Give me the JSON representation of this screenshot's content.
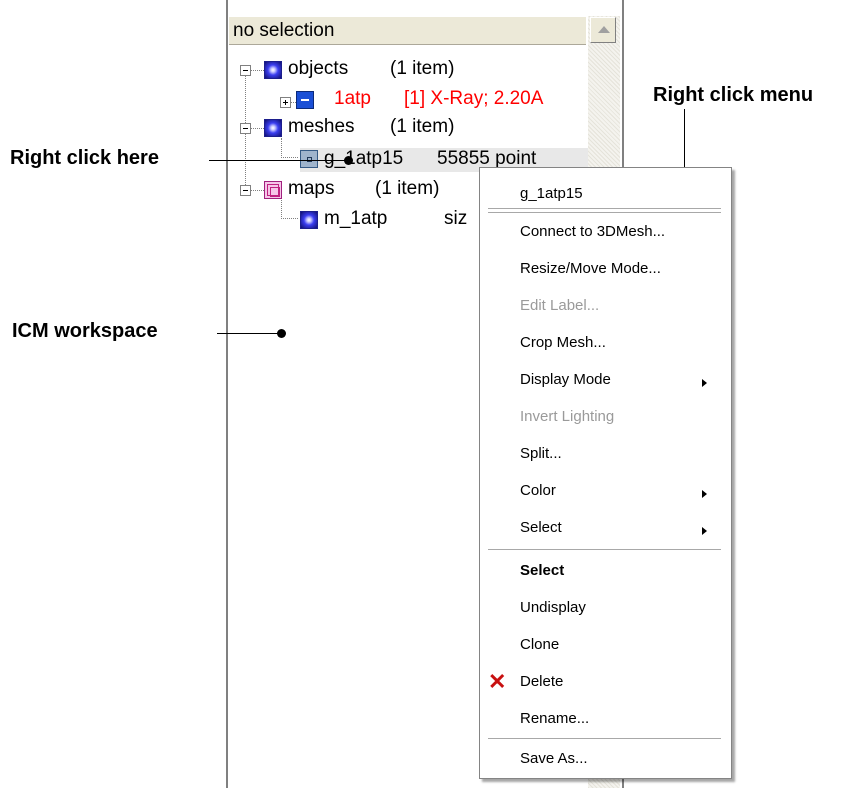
{
  "workspace": {
    "header": "no selection"
  },
  "tree": {
    "objects": {
      "label": "objects",
      "count": "(1 item)"
    },
    "object_item": {
      "name": "1atp",
      "detail": "[1] X-Ray; 2.20A"
    },
    "meshes": {
      "label": "meshes",
      "count": "(1 item)"
    },
    "mesh_item": {
      "name": "g_1atp15",
      "detail": "55855 point"
    },
    "maps": {
      "label": "maps",
      "count": "(1 item)"
    },
    "map_item": {
      "name": "m_1atp",
      "detail": "siz"
    }
  },
  "annotations": {
    "right_click_menu": "Right click menu",
    "right_click_here": "Right click here",
    "icm_workspace": "ICM workspace"
  },
  "menu": {
    "title": "g_1atp15",
    "items": {
      "connect": "Connect to 3DMesh...",
      "resize": "Resize/Move Mode...",
      "edit_label": "Edit Label...",
      "crop": "Crop Mesh...",
      "display_mode": "Display Mode",
      "invert": "Invert Lighting",
      "split": "Split...",
      "color": "Color",
      "select_sub": "Select",
      "select": "Select",
      "undisplay": "Undisplay",
      "clone": "Clone",
      "delete": "Delete",
      "rename": "Rename...",
      "save_as": "Save As..."
    }
  },
  "icons": {
    "objects": "sphere-icon",
    "object_item": "minus-square-icon",
    "meshes": "sphere-icon",
    "mesh_item": "mesh-icon",
    "maps": "map-icon",
    "map_item": "sphere-icon",
    "delete": "red-x-icon",
    "submenu": "triangle-right-icon"
  },
  "colors": {
    "object_item_text": "#ff0000",
    "disabled_text": "#9a9a9a",
    "delete_icon": "#c81010"
  }
}
